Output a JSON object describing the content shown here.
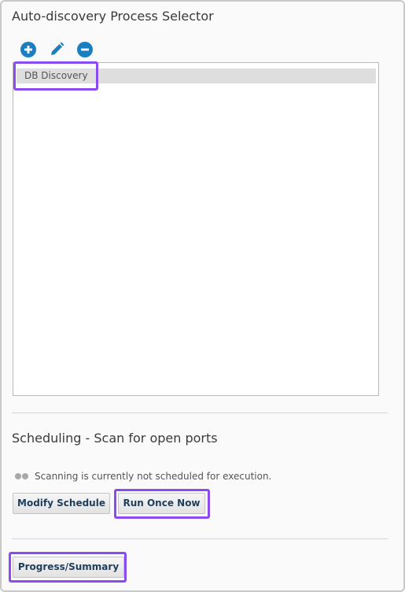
{
  "selector": {
    "title": "Auto-discovery Process Selector",
    "toolbar": {
      "add_icon": "plus-circle-icon",
      "edit_icon": "pencil-icon",
      "remove_icon": "minus-circle-icon",
      "icon_color": "#1a7fc1"
    },
    "items": [
      {
        "label": "DB Discovery",
        "selected": true
      }
    ]
  },
  "scheduling": {
    "title": "Scheduling - Scan for open ports",
    "status_text": "Scanning is currently not scheduled for execution.",
    "modify_label": "Modify Schedule",
    "run_once_label": "Run Once Now"
  },
  "progress": {
    "label": "Progress/Summary"
  },
  "colors": {
    "highlight": "#8a4cf0",
    "button_text": "#1f3e5c",
    "selected_row": "#dedede"
  }
}
